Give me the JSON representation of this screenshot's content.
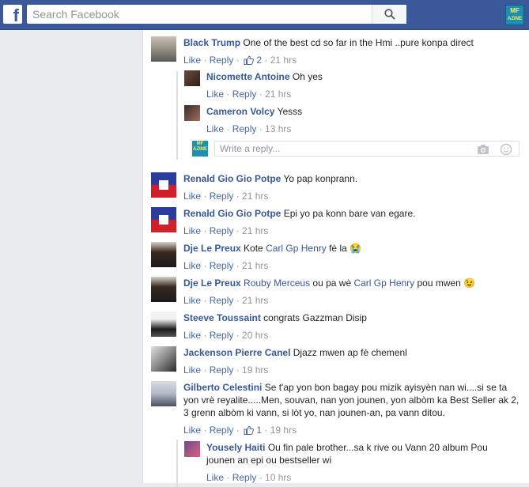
{
  "topbar": {
    "logo_letter": "f",
    "search_placeholder": "Search Facebook",
    "brand_logo_line1": "MF",
    "brand_logo_line2": "AZINE"
  },
  "actions": {
    "like": "Like",
    "reply": "Reply",
    "dot": " · "
  },
  "comments": [
    {
      "author": "Black Trump",
      "text": "One of the best cd so far in the Hmi ..pure konpa direct",
      "likes": "2",
      "time": "21 hrs"
    },
    {
      "author": "Nicomette Antoine",
      "text": "Oh yes",
      "time": "21 hrs"
    },
    {
      "author": "Cameron Volcy",
      "text": "Yesss",
      "time": "13 hrs"
    },
    {
      "author": "Renald Gio Gio Potpe",
      "text": "Yo pap konprann.",
      "time": "21 hrs"
    },
    {
      "author": "Renald Gio Gio Potpe",
      "text": "Epi yo pa konn bare van egare.",
      "time": "21 hrs"
    },
    {
      "author": "Dje Le Preux",
      "pre": "Kote ",
      "mention": "Carl Gp Henry",
      "text": " fè la 😭",
      "time": "21 hrs"
    },
    {
      "author": "Dje Le Preux",
      "mention": "Rouby Merceus",
      "text": " ou pa wè ",
      "mention2": "Carl Gp Henry",
      "text2": " pou mwen 😉",
      "time": "21 hrs"
    },
    {
      "author": "Steeve Toussaint",
      "text": "congrats Gazzman Disip",
      "time": "20 hrs"
    },
    {
      "author": "Jackenson Pierre Canel",
      "text": "Djazz mwen ap fè chemenl",
      "time": "19 hrs"
    },
    {
      "author": "Gilberto Celestini",
      "text": "Se t'ap yon bon bagay pou mizik ayisyèn nan wi....si se ta yon vrè reyalite.....Men, souvan, nan yon jounen, yon albòm ka Best Seller ak 2, 3 grenn albòm ki vann, si lòt yo, nan jounen-an, pa vann ditou.",
      "likes": "1",
      "time": "19 hrs"
    },
    {
      "author": "Yousely Haiti",
      "text": "Ou fin pale brother...sa k rive ou Vann 20 album Pou jounen an epi ou bestseller wi",
      "time": "10 hrs"
    }
  ],
  "reply_box": {
    "placeholder": "Write a reply..."
  },
  "colors": {
    "fb_blue": "#3b5998",
    "link": "#365899",
    "meta": "#90949c",
    "action": "#4b67a1"
  }
}
